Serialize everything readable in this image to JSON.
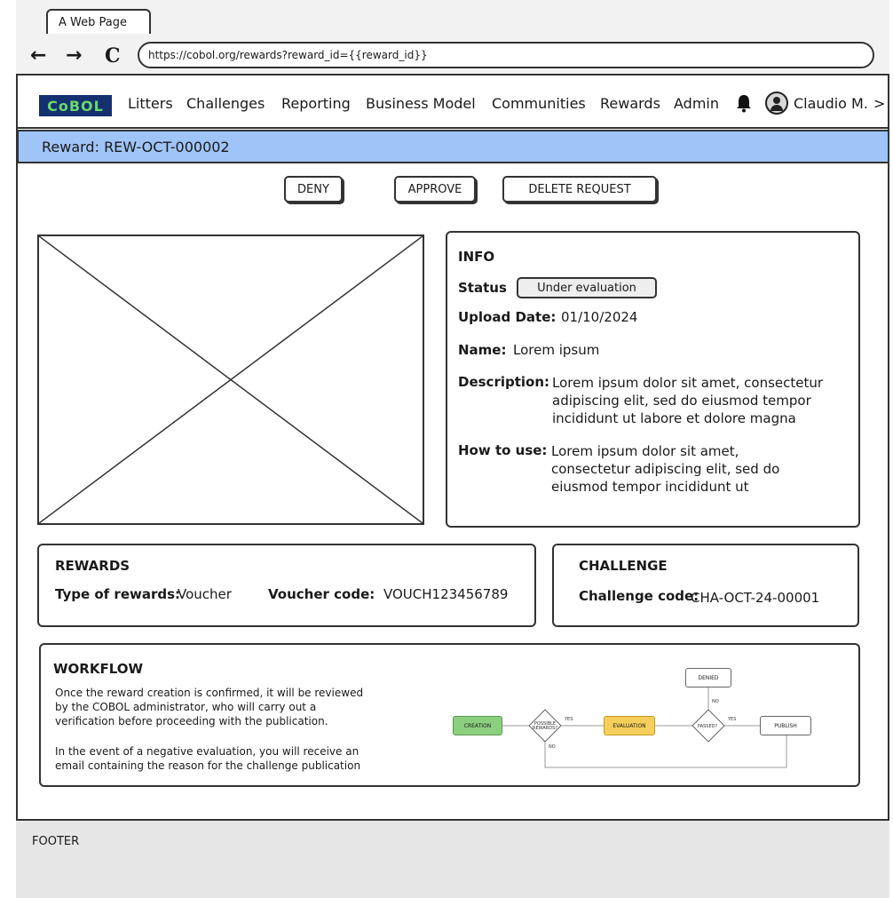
{
  "browser": {
    "tab_title": "A Web Page",
    "back_icon": "←",
    "forward_icon": "→",
    "reload_icon": "C",
    "url": "https://cobol.org/rewards?reward_id={{reward_id}}"
  },
  "nav": {
    "logo": "CoBOL",
    "items": [
      "Litters",
      "Challenges",
      "Reporting",
      "Business Model",
      "Communities",
      "Rewards",
      "Admin"
    ],
    "user_name": "Claudio M.",
    "user_chevron": ">"
  },
  "subheader": {
    "title": "Reward: REW-OCT-000002"
  },
  "actions": {
    "deny": "DENY",
    "approve": "APPROVE",
    "delete": "DELETE REQUEST"
  },
  "info": {
    "title": "INFO",
    "status_label": "Status",
    "status_value": "Under evaluation",
    "upload_label": "Upload Date:",
    "upload_value": "01/10/2024",
    "name_label": "Name:",
    "name_value": "Lorem ipsum",
    "description_label": "Description:",
    "description_lines": [
      "Lorem ipsum dolor sit amet, consectetur",
      "adipiscing elit, sed do eiusmod tempor",
      "incididunt ut labore et dolore magna"
    ],
    "howto_label": "How to use:",
    "howto_lines": [
      "Lorem ipsum dolor sit amet,",
      "consectetur adipiscing elit, sed do",
      "eiusmod tempor incididunt ut"
    ]
  },
  "rewards": {
    "title": "REWARDS",
    "type_label": "Type of rewards:",
    "type_value": "Voucher",
    "code_label": "Voucher code:",
    "code_value": "VOUCH123456789"
  },
  "challenge": {
    "title": "CHALLENGE",
    "code_label": "Challenge code:",
    "code_value": "CHA-OCT-24-00001"
  },
  "workflow": {
    "title": "WORKFLOW",
    "para1_lines": [
      "Once the reward creation is confirmed, it will be reviewed",
      "by the COBOL administrator, who will carry out a",
      "verification before proceeding with the publication."
    ],
    "para2_lines": [
      "In the event of a negative evaluation, you will receive an",
      "email containing the reason for the challenge publication"
    ],
    "diagram": {
      "creation": "CREATION",
      "rewards_node": "POSSIBLE REWARDS?",
      "evaluation": "EVALUATION",
      "passed": "PASSED?",
      "denied": "DENIED",
      "publish": "PUBLISH",
      "yes1": "YES",
      "no1": "NO",
      "yes2": "YES",
      "no2": "NO",
      "colors": {
        "creation": "#8ccf7e",
        "evaluation": "#f5cf5b"
      }
    }
  },
  "footer": {
    "label": "FOOTER"
  }
}
